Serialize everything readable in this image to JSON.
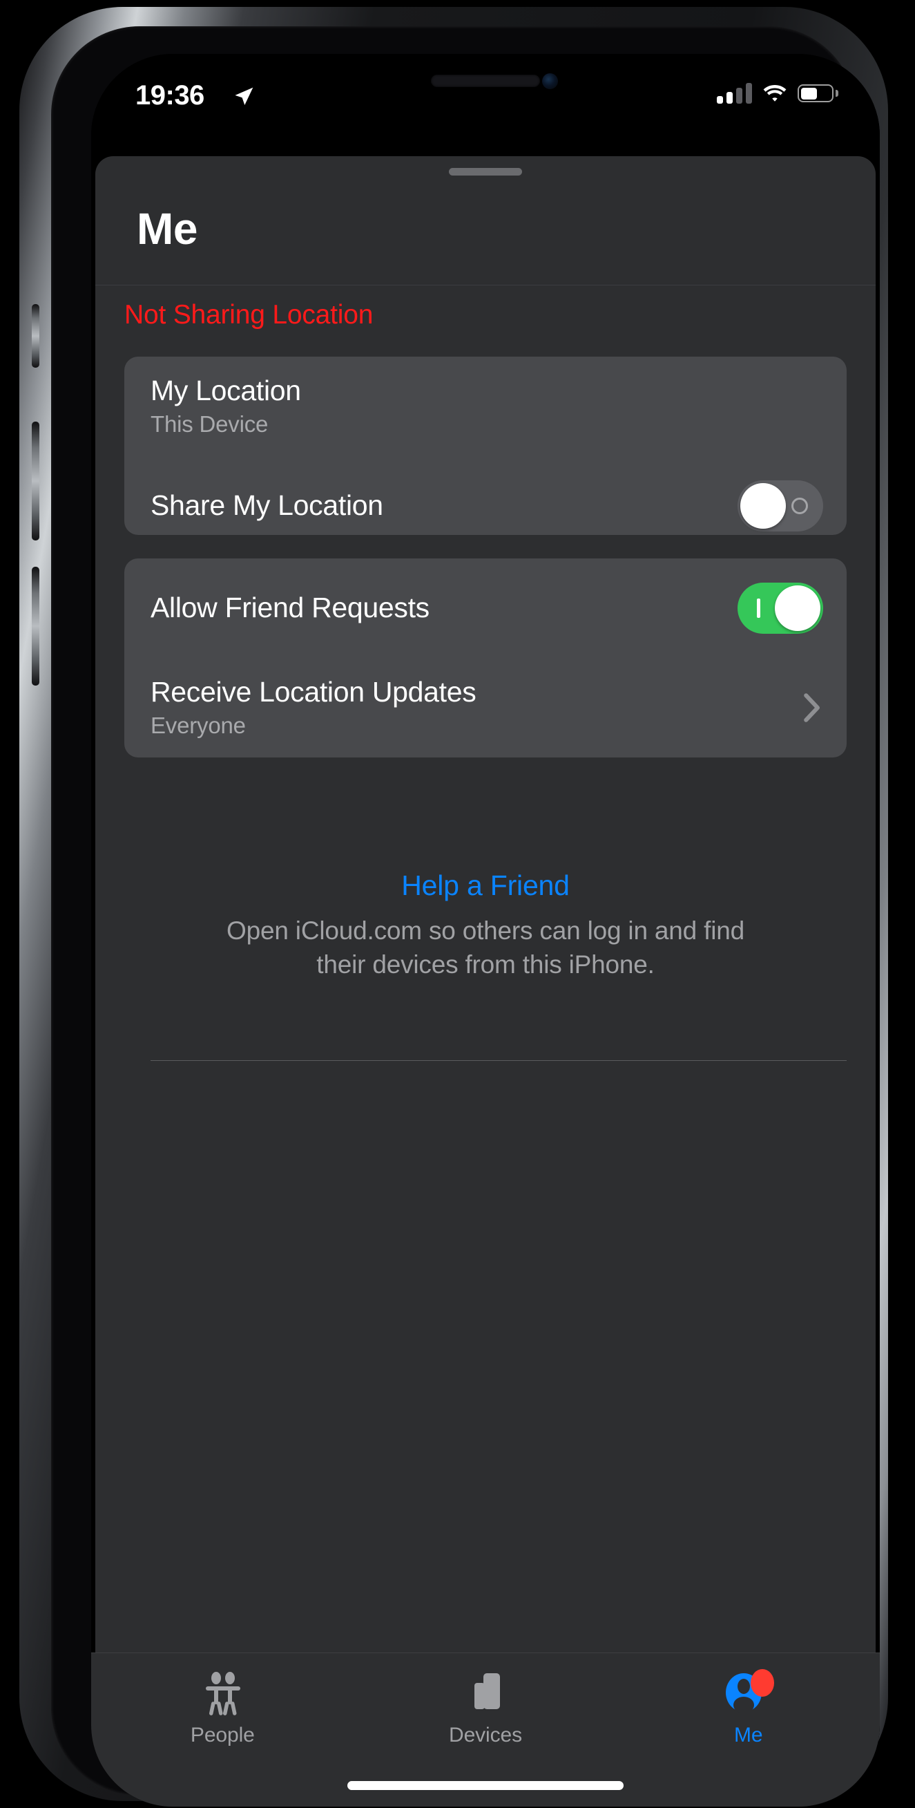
{
  "status_bar": {
    "time": "19:36",
    "location_arrow_icon": "location-arrow-icon",
    "cellular_icon": "cellular-signal-icon",
    "cellular_bars_filled": 2,
    "cellular_bars_total": 4,
    "wifi_icon": "wifi-icon",
    "battery_icon": "battery-icon",
    "battery_level_percent": 55
  },
  "sheet": {
    "grabber": "sheet-grabber-handle",
    "title": "Me",
    "sharing_status": "Not Sharing Location",
    "sharing_status_color": "#ff1a1a"
  },
  "location_card": {
    "my_location": {
      "title": "My Location",
      "subtitle": "This Device"
    },
    "share_my_location": {
      "title": "Share My Location",
      "toggle_state": "off",
      "off_mark": "O"
    }
  },
  "prefs_card": {
    "allow_friend_requests": {
      "title": "Allow Friend Requests",
      "toggle_state": "on",
      "on_mark": "I",
      "on_color": "#35c759"
    },
    "receive_location_updates": {
      "title": "Receive Location Updates",
      "subtitle": "Everyone",
      "chevron_icon": "chevron-right-icon"
    }
  },
  "help": {
    "link_label": "Help a Friend",
    "link_color": "#0a84ff",
    "description": "Open iCloud.com so others can log in and find their devices from this iPhone."
  },
  "tab_bar": {
    "tabs": [
      {
        "label": "People",
        "icon": "two-people-icon",
        "active": false,
        "badge": false
      },
      {
        "label": "Devices",
        "icon": "devices-icon",
        "active": false,
        "badge": false
      },
      {
        "label": "Me",
        "icon": "person-circle-icon",
        "active": true,
        "badge": true
      }
    ],
    "active_color": "#0a84ff",
    "inactive_color": "#a0a1a4",
    "badge_color": "#ff3b30"
  }
}
